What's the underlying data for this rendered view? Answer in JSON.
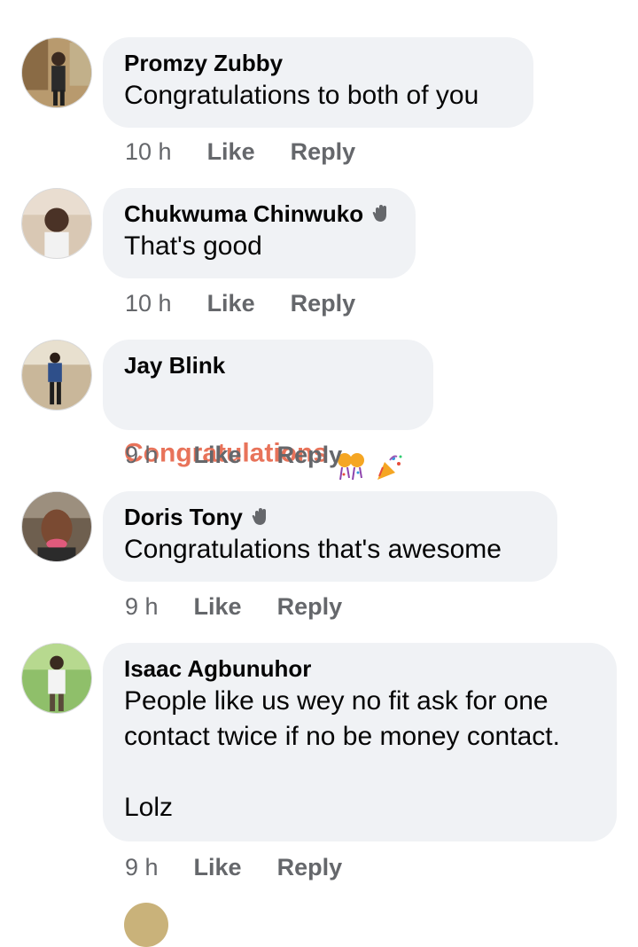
{
  "comments": [
    {
      "author": "Promzy Zubby",
      "text": "Congratulations to both of you",
      "time": "10 h",
      "badge": false
    },
    {
      "author": "Chukwuma Chinwuko",
      "text": "That's good",
      "time": "10 h",
      "badge": true
    },
    {
      "author": "Jay Blink",
      "text": "Congratulations",
      "time": "9 h",
      "badge": false,
      "emojis": [
        "celebration-balls-emoji",
        "party-popper-emoji"
      ]
    },
    {
      "author": "Doris Tony",
      "text": "Congratulations that's awesome",
      "time": "9 h",
      "badge": true
    },
    {
      "author": "Isaac Agbunuhor",
      "text": "People like us wey no fit ask for one\ncontact twice if no be money contact.\n\nLolz",
      "time": "9 h",
      "badge": false
    }
  ],
  "actions": {
    "like": "Like",
    "reply": "Reply"
  },
  "colors": {
    "bubble": "#f0f2f5",
    "action": "#65676b",
    "congrats": "#e8735a"
  }
}
